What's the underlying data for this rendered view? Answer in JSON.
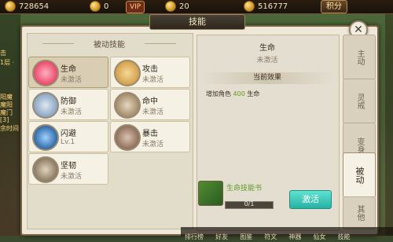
{
  "topbar": {
    "currency1": "728654",
    "currency2": "0",
    "vip": "VIP",
    "currency3": "20",
    "currency4": "516777",
    "points_label": "积分"
  },
  "left_hud": [
    "击",
    "1层 ·",
    "阳魔",
    "魔阳",
    "魔门",
    "[3]",
    "余时间"
  ],
  "panel": {
    "title": "技能"
  },
  "passive": {
    "section_title": "被动技能"
  },
  "skills": [
    {
      "name": "生命",
      "state": "未激活",
      "color": "#e94a6a"
    },
    {
      "name": "攻击",
      "state": "未激活",
      "color": "#d5a04a"
    },
    {
      "name": "防御",
      "state": "未激活",
      "color": "#8aa6c4"
    },
    {
      "name": "命中",
      "state": "未激活",
      "color": "#a38a6a"
    },
    {
      "name": "闪避",
      "state": "Lv.1",
      "color": "#2f6aa8"
    },
    {
      "name": "暴击",
      "state": "未激活",
      "color": "#8f6f5a"
    },
    {
      "name": "坚韧",
      "state": "未激活",
      "color": "#8c7a62"
    }
  ],
  "detail": {
    "title": "生命",
    "status": "未激活",
    "effect_header": "当前效果",
    "effect_prefix": "增加角色",
    "effect_value": "400",
    "effect_suffix": "生命",
    "book_name": "生命技能书",
    "book_progress_text": "0/1",
    "book_progress": 0,
    "activate_label": "激活"
  },
  "tabs": [
    {
      "label": "主动",
      "active": false
    },
    {
      "label": "灵戒",
      "active": false
    },
    {
      "label": "变身",
      "active": false
    },
    {
      "label": "被动",
      "active": true
    },
    {
      "label": "其他",
      "active": false
    }
  ],
  "bottom_bar": [
    "排行榜",
    "好友",
    "图鉴",
    "符文",
    "神器",
    "仙女",
    "技能"
  ],
  "colors": {
    "accent": "#27b1a2",
    "highlight": "#5f9a24"
  }
}
